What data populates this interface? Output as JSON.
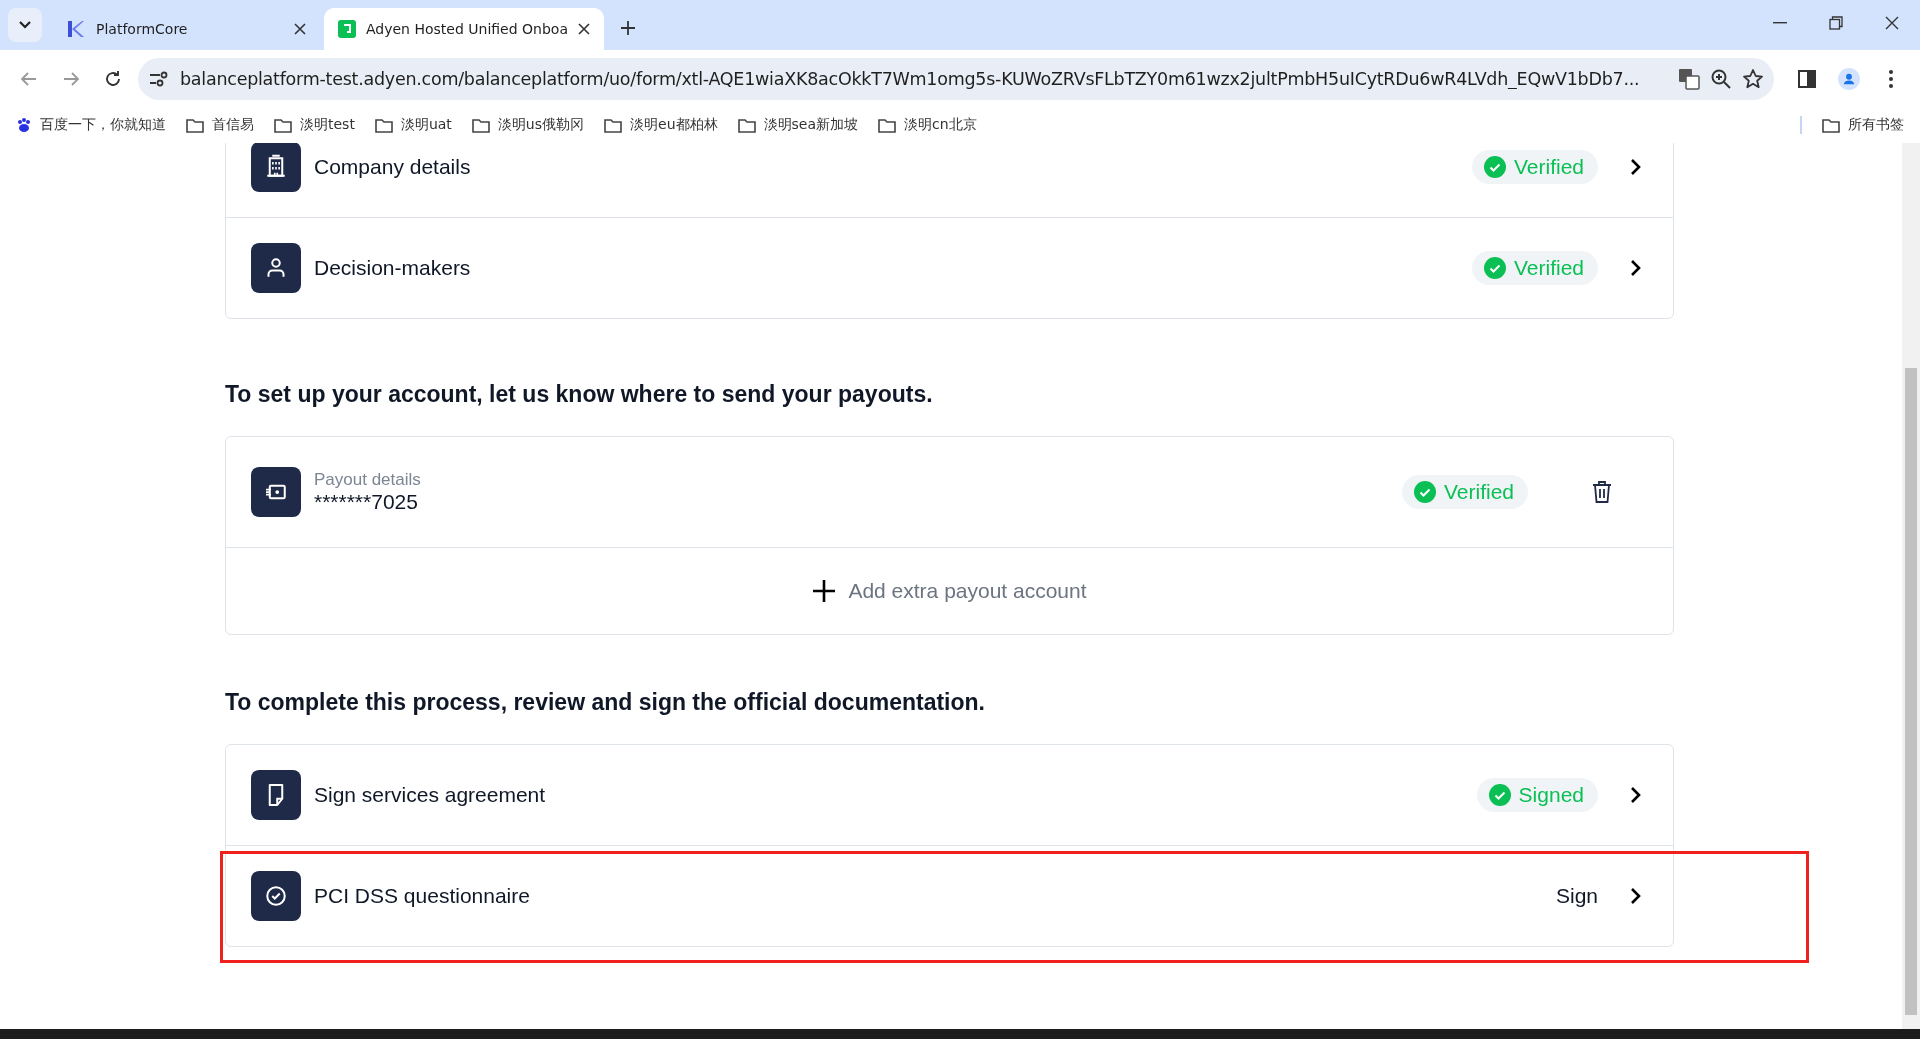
{
  "browser": {
    "tabs": [
      {
        "title": "PlatformCore",
        "selected": false
      },
      {
        "title": "Adyen Hosted Unified Onboa",
        "selected": true
      }
    ],
    "url": "balanceplatform-test.adyen.com/balanceplatform/uo/form/xtl-AQE1wiaXK8acOkkT7Wm1omg5s-KUWoZRVsFLbTZY0m61wzx2jultPmbH5uICytRDu6wR4LVdh_EQwV1bDb7...",
    "bookmarks": [
      {
        "label": "百度一下，你就知道",
        "kind": "site"
      },
      {
        "label": "首信易",
        "kind": "folder"
      },
      {
        "label": "淡明test",
        "kind": "folder"
      },
      {
        "label": "淡明uat",
        "kind": "folder"
      },
      {
        "label": "淡明us俄勒冈",
        "kind": "folder"
      },
      {
        "label": "淡明eu都柏林",
        "kind": "folder"
      },
      {
        "label": "淡明sea新加坡",
        "kind": "folder"
      },
      {
        "label": "淡明cn北京",
        "kind": "folder"
      }
    ],
    "all_bookmarks": "所有书签"
  },
  "sections": [
    {
      "rows": [
        {
          "title": "Company details",
          "status": {
            "kind": "badge",
            "label": "Verified"
          },
          "highlighted": false
        },
        {
          "title": "Decision-makers",
          "status": {
            "kind": "badge",
            "label": "Verified"
          },
          "highlighted": false
        }
      ]
    },
    {
      "heading": "To set up your account, let us know where to send your payouts.",
      "payout": {
        "label": "Payout details",
        "value": "*******7025",
        "status": "Verified"
      },
      "add_action": "Add extra payout account"
    },
    {
      "heading": "To complete this process, review and sign the official documentation.",
      "rows": [
        {
          "title": "Sign services agreement",
          "status": {
            "kind": "badge",
            "label": "Signed"
          },
          "highlighted": false
        },
        {
          "title": "PCI DSS questionnaire",
          "status": {
            "kind": "text",
            "label": "Sign"
          },
          "highlighted": true
        }
      ]
    }
  ]
}
